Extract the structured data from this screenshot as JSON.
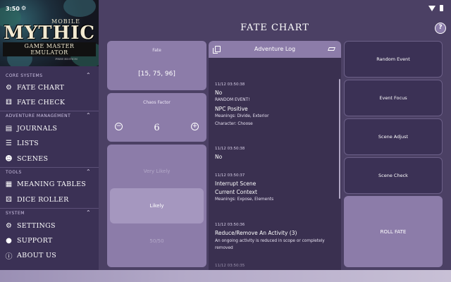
{
  "status": {
    "time": "3:50",
    "gear_icon": "gear-icon",
    "wifi_icon": "wifi-icon",
    "battery_icon": "battery-icon"
  },
  "banner": {
    "line1": "MOBILE",
    "line2": "MYTHIC",
    "line3": "GAME MASTER EMULATOR",
    "line4": "FREE EDITION"
  },
  "sidebar": {
    "sections": [
      {
        "label": "CORE SYSTEMS",
        "items": [
          {
            "label": "FATE CHART",
            "icon": "cog-icon"
          },
          {
            "label": "FATE CHECK",
            "icon": "dice-icon"
          }
        ]
      },
      {
        "label": "ADVENTURE MANAGEMENT",
        "items": [
          {
            "label": "JOURNALS",
            "icon": "book-icon"
          },
          {
            "label": "LISTS",
            "icon": "list-icon"
          },
          {
            "label": "SCENES",
            "icon": "theater-masks-icon"
          }
        ]
      },
      {
        "label": "TOOLS",
        "items": [
          {
            "label": "MEANING TABLES",
            "icon": "table-icon"
          },
          {
            "label": "DICE ROLLER",
            "icon": "dice-pair-icon"
          }
        ]
      },
      {
        "label": "SYSTEM",
        "items": [
          {
            "label": "SETTINGS",
            "icon": "settings-icon"
          },
          {
            "label": "SUPPORT",
            "icon": "support-icon"
          },
          {
            "label": "ABOUT US",
            "icon": "info-icon"
          }
        ]
      }
    ]
  },
  "header": {
    "title": "FATE CHART",
    "help_label": "?"
  },
  "fate": {
    "caption": "Fate",
    "value": "[15, 75, 96]"
  },
  "chaos": {
    "caption": "Chaos Factor",
    "value": "6",
    "minus": "−",
    "plus": "+"
  },
  "odds": {
    "options": [
      "Very Likely",
      "Likely",
      "50/50"
    ],
    "selected": "Likely"
  },
  "log": {
    "title": "Adventure Log",
    "entries": [
      {
        "time": "11/12 03:50:38",
        "result": "No",
        "event": "RANDOM EVENT!",
        "focus": "NPC Positive",
        "meanings": "Meanings: Divide, Exterior",
        "character": "Character: Choose"
      },
      {
        "time": "11/12 03:50:38",
        "result": "No"
      },
      {
        "time": "11/12 03:50:37",
        "result": "Interrupt Scene",
        "focus": "Current Context",
        "meanings": "Meanings: Expose, Elements"
      },
      {
        "time": "11/12 03:50:36",
        "result": "Reduce/Remove An Activity (3)",
        "description": "An ongoing activity is reduced in scope or completely removed"
      },
      {
        "time": "11/12 03:50:35"
      }
    ]
  },
  "actions": [
    "Random Event",
    "Event Focus",
    "Scene Adjust",
    "Scene Check"
  ],
  "roll": "ROLL FATE",
  "colors": {
    "card": "#8c7ca9",
    "sidebar": "#3b3155",
    "background": "#4b4064",
    "log": "#3a3050"
  }
}
